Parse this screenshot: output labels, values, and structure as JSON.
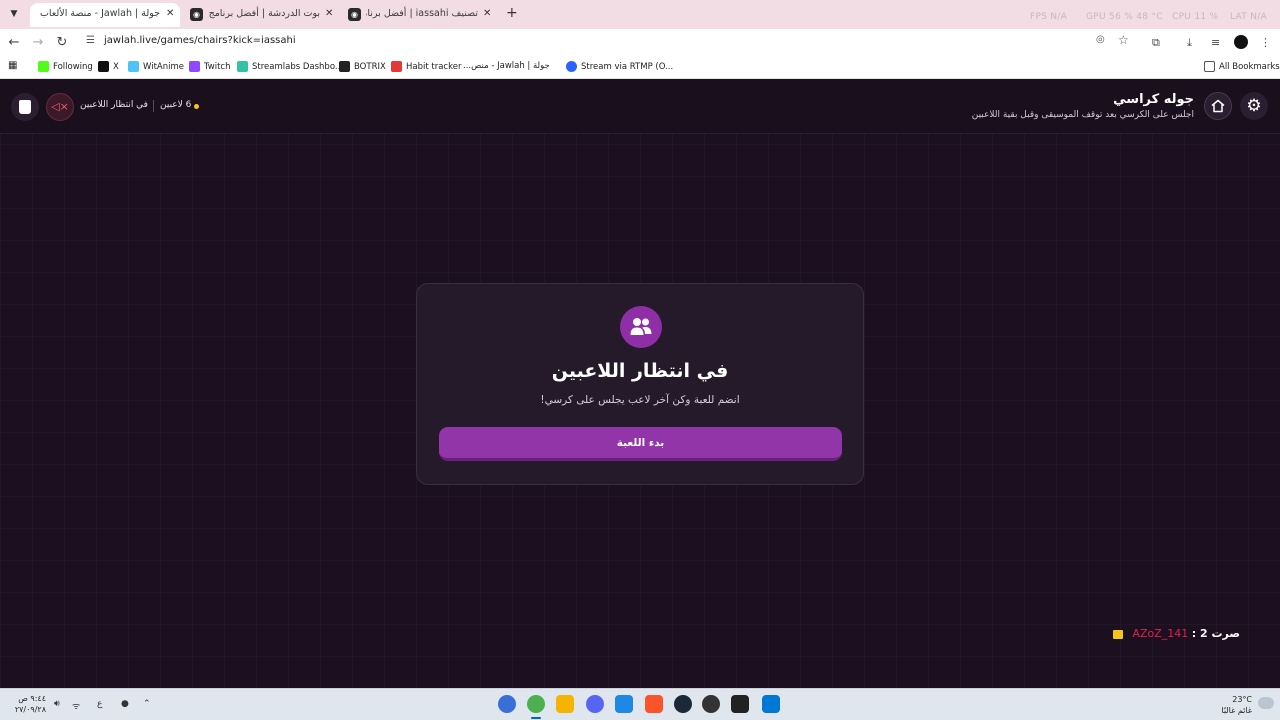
{
  "browser": {
    "tabs": [
      {
        "title": "جولة | Jawlah - منصة الألعاب التفاعلية",
        "active": true
      },
      {
        "title": "بوت الدردشة | أفضل برنامج لتعزيز",
        "active": false
      },
      {
        "title": "تصنيف iassahi | أفضل برنامج لتعزيز",
        "active": false
      }
    ],
    "new_tab": "+",
    "perf": {
      "fps": "FPS  N/A",
      "gpu": "GPU  56 %  48 °C",
      "cpu": "CPU  11 %",
      "lat": "LAT  N/A"
    },
    "url": "jawlah.live/games/chairs?kick=iassahi",
    "bookmarks": [
      {
        "label": "Following",
        "color": "#53fc18"
      },
      {
        "label": "X",
        "color": "#111111"
      },
      {
        "label": "WitAnime",
        "color": "#4fc3f7"
      },
      {
        "label": "Twitch",
        "color": "#9146ff"
      },
      {
        "label": "Streamlabs Dashbo...",
        "color": "#31c3a2"
      },
      {
        "label": "BOTRIX",
        "color": "#222222"
      },
      {
        "label": "Habit tracker",
        "color": "#e53935"
      },
      {
        "label": "جولة | Jawlah - منص...",
        "color": "#e0e0e0"
      },
      {
        "label": "Stream via RTMP (O...",
        "color": "#2962ff"
      }
    ],
    "all_bookmarks": "All Bookmarks"
  },
  "header": {
    "title": "جوله كراسي",
    "subtitle": "اجلس على الكرسي بعد توقف الموسيقى وقبل بقية اللاعبين",
    "status": "في انتظار اللاعبين",
    "players": "6 لاعبين"
  },
  "card": {
    "title": "في انتظار اللاعبين",
    "subtitle": "انضم للعبة وكن آخر لاعب يجلس على كرسي!",
    "button": "بدء اللعبة"
  },
  "winner": {
    "label": "صرت 2 :",
    "username": "AZoZ_141"
  },
  "taskbar": {
    "time": "٩:٤٤ ص",
    "date": "٢٧/٠٩/٢٨",
    "lang": "ع",
    "weather_temp": "23°C",
    "weather_desc": "غائم غالبًا"
  },
  "colors": {
    "accent": "#9235a8",
    "background": "#1c1020",
    "card": "#241a29",
    "danger": "#e0234a",
    "gold": "#f5c518"
  }
}
